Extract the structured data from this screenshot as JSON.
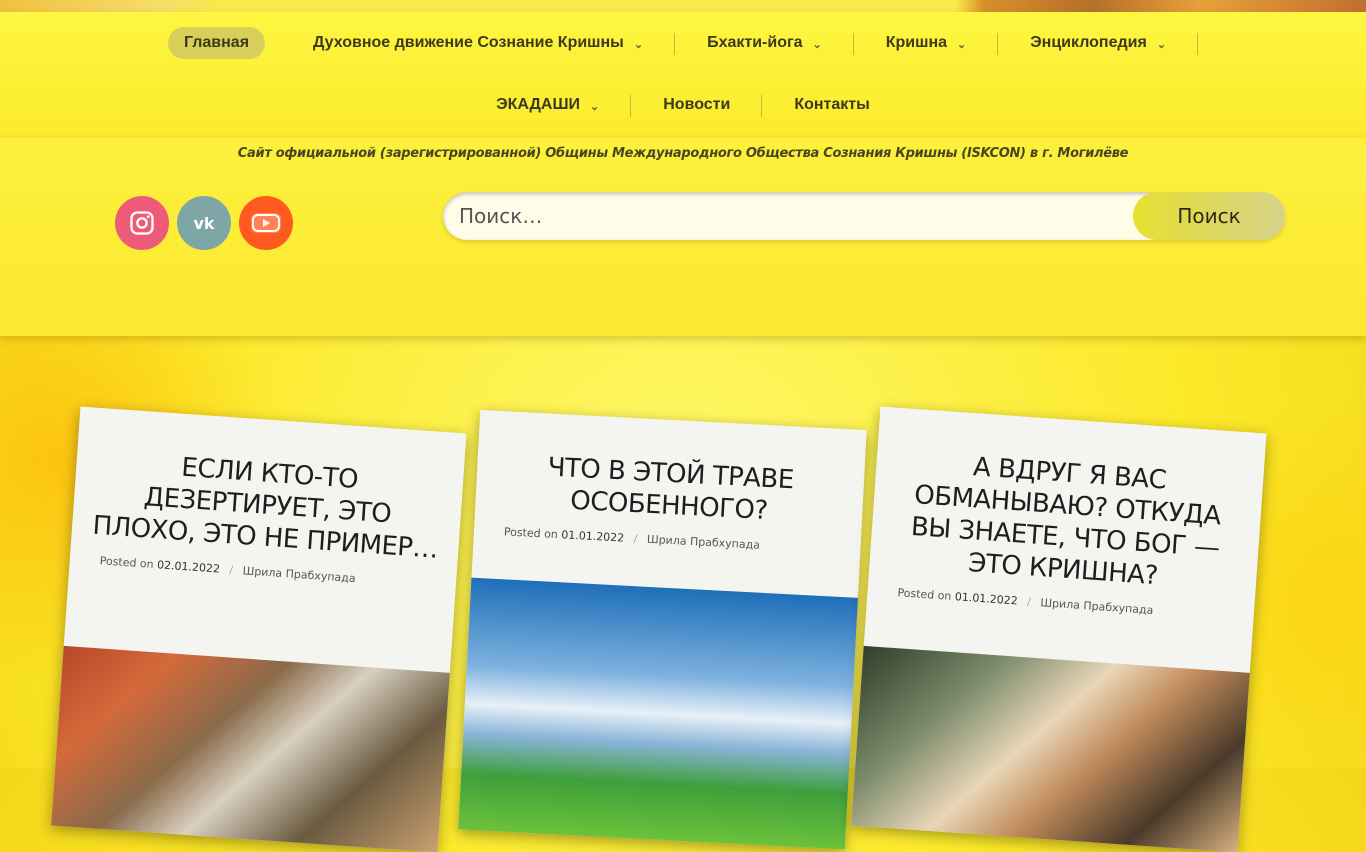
{
  "nav": {
    "row1": [
      {
        "label": "Главная",
        "active": true,
        "dropdown": false
      },
      {
        "label": "Духовное движение Сознание Кришны",
        "dropdown": true
      },
      {
        "label": "Бхакти-йога",
        "dropdown": true
      },
      {
        "label": "Кришна",
        "dropdown": true
      },
      {
        "label": "Энциклопедия",
        "dropdown": true
      }
    ],
    "row2": [
      {
        "label": "ЭКАДАШИ",
        "dropdown": true
      },
      {
        "label": "Новости",
        "dropdown": false
      },
      {
        "label": "Контакты",
        "dropdown": false
      }
    ],
    "chevron": "⌄"
  },
  "tagline": "Сайт официальной (зарегистрированной) Общины Международного Общества Сознания Кришны (ISKCON) в г. Могилёве",
  "social": {
    "instagram": "instagram-icon",
    "vk": "vk-icon",
    "youtube": "youtube-icon",
    "vk_text": "vk"
  },
  "search": {
    "placeholder": "Поиск…",
    "button": "Поиск"
  },
  "posts": [
    {
      "title": "ЕСЛИ КТО-ТО ДЕЗЕРТИРУЕТ, ЭТО ПЛОХО, ЭТО НЕ ПРИМЕР…",
      "posted_on": "Posted on",
      "date": "02.01.2022",
      "author": "Шрила Прабхупада"
    },
    {
      "title": "ЧТО В ЭТОЙ ТРАВЕ ОСОБЕННОГО?",
      "posted_on": "Posted on",
      "date": "01.01.2022",
      "author": "Шрила Прабхупада"
    },
    {
      "title": "А ВДРУГ Я ВАС ОБМАНЫВАЮ? ОТКУДА ВЫ ЗНАЕТЕ, ЧТО БОГ — ЭТО КРИШНА?",
      "posted_on": "Posted on",
      "date": "01.01.2022",
      "author": "Шрила Прабхупада"
    }
  ],
  "colors": {
    "accent": "#fbeb2c",
    "instagram": "#ee5b78",
    "vk": "#7fa6a6",
    "youtube": "#ff5a1f"
  }
}
